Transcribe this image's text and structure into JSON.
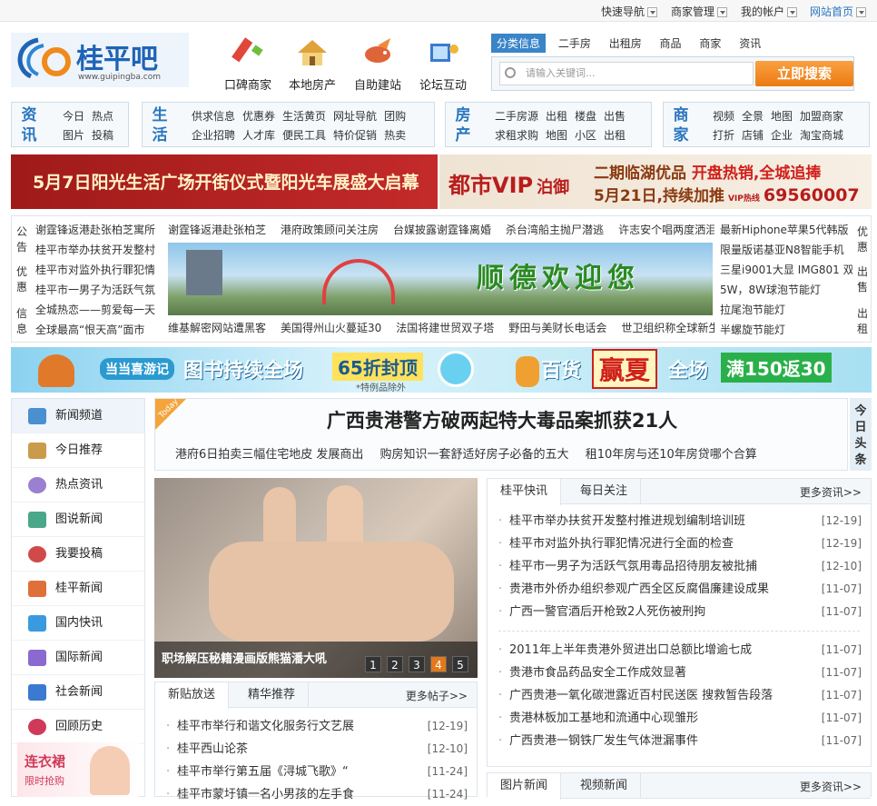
{
  "topbar": {
    "quick_nav": "快速导航",
    "merchant_mgmt": "商家管理",
    "my_account": "我的帐户",
    "home": "网站首页"
  },
  "logo": {
    "name": "桂平吧",
    "url_text": "www.guipingba.com"
  },
  "nav_icons": [
    {
      "label": "口碑商家",
      "icon": "pencil-icon"
    },
    {
      "label": "本地房产",
      "icon": "house-icon"
    },
    {
      "label": "自助建站",
      "icon": "bird-icon"
    },
    {
      "label": "论坛互动",
      "icon": "film-icon"
    }
  ],
  "search": {
    "tabs": [
      "分类信息",
      "二手房",
      "出租房",
      "商品",
      "商家",
      "资讯"
    ],
    "placeholder": "请输入关键词...",
    "button": "立即搜索"
  },
  "categories": [
    {
      "title": "资讯",
      "row1": [
        "今日",
        "热点"
      ],
      "row2": [
        "图片",
        "投稿"
      ]
    },
    {
      "title": "生活",
      "row1": [
        "供求信息",
        "优惠券",
        "生活黄页",
        "网址导航",
        "团购"
      ],
      "row2": [
        "企业招聘",
        "人才库",
        "便民工具",
        "特价促销",
        "热卖"
      ]
    },
    {
      "title": "房产",
      "row1": [
        "二手房源",
        "出租",
        "楼盘",
        "出售"
      ],
      "row2": [
        "求租求购",
        "地图",
        "小区",
        "出租"
      ]
    },
    {
      "title": "商家",
      "row1": [
        "视频",
        "全景",
        "地图",
        "加盟商家"
      ],
      "row2": [
        "打折",
        "店铺",
        "企业",
        "淘宝商城"
      ]
    }
  ],
  "banners": {
    "left": "5月7日阳光生活广场开街仪式暨阳光车展盛大启幕",
    "right_brand": "都市VIP",
    "right_sub": "泊御",
    "right_line1a": "二期临湖优品",
    "right_line1b": "开盘热销,全城追捧",
    "right_line2": "5月21日,持续加推",
    "right_vip": "VIP热线",
    "right_phone": "69560007"
  },
  "news3": {
    "left_labels": [
      "公告",
      "优惠",
      "信息"
    ],
    "right_labels": [
      "优惠",
      "出售",
      "出租"
    ],
    "col1": [
      "谢霆锋返港赴张柏芝寓所",
      "桂平市举办扶贫开发整村",
      "桂平市对监外执行罪犯情",
      "桂平市一男子为活跃气氛",
      "全城热恋——剪爱每一天",
      "全球最高“恨天高”面市"
    ],
    "col2a": [
      "谢霆锋返港赴张柏芝",
      "港府政策顾问关注房",
      "台媒披露谢霆锋离婚",
      "杀台湾船主抛尸潜逃",
      "许志安个唱两度洒泪"
    ],
    "col2b": [
      "维基解密网站遭黑客",
      "美国得州山火蔓延30",
      "法国将建世贸双子塔",
      "野田与美财长电话会",
      "世卫组织称全球新生"
    ],
    "center_text": "顺德欢迎您",
    "col3": [
      "最新Hiphone苹果5代韩版",
      "限量版诺基亚N8智能手机",
      "三星i9001大显 IMG801 双",
      "5W，8W球泡节能灯",
      "拉尾泡节能灯",
      "半螺旋节能灯"
    ]
  },
  "book_banner": {
    "brand": "当当喜游记",
    "t1": "图书持续全场",
    "t2": "65折封顶",
    "note": "*特例品除外",
    "t3": "百货",
    "t4": "赢夏",
    "t5": "全场",
    "t6": "满150返30"
  },
  "sidebar": [
    {
      "label": "新闻频道",
      "color": "#4a8fd0"
    },
    {
      "label": "今日推荐",
      "color": "#c99b4a"
    },
    {
      "label": "热点资讯",
      "color": "#9b7fd0"
    },
    {
      "label": "图说新闻",
      "color": "#4aa88a"
    },
    {
      "label": "我要投稿",
      "color": "#d04a4a"
    },
    {
      "label": "桂平新闻",
      "color": "#e0703a"
    },
    {
      "label": "国内快讯",
      "color": "#3a9ae0"
    },
    {
      "label": "国际新闻",
      "color": "#8a6ad0"
    },
    {
      "label": "社会新闻",
      "color": "#3a7ad0"
    },
    {
      "label": "回顾历史",
      "color": "#d03a5a"
    }
  ],
  "sidebar_ad": {
    "t1": "连衣裙",
    "t2": "限时抢购"
  },
  "headline": {
    "badge": "Today",
    "title": "广西贵港警方破两起特大毒品案抓获21人",
    "subs": [
      "港府6日拍卖三幅住宅地皮 发展商出",
      "购房知识一套舒适好房子必备的五大",
      "租10年房与还10年房贷哪个合算"
    ],
    "side_label": "今日头条"
  },
  "photo": {
    "caption": "职场解压秘籍漫画版熊猫潘大吼",
    "pages": [
      "1",
      "2",
      "3",
      "4",
      "5"
    ],
    "active": "4"
  },
  "forum_panel": {
    "tabs": [
      "新贴放送",
      "精华推荐"
    ],
    "more": "更多帖子>>",
    "items": [
      {
        "title": "桂平市举行和谐文化服务行文艺展",
        "date": "[12-19]"
      },
      {
        "title": "桂平西山论茶",
        "date": "[12-10]"
      },
      {
        "title": "桂平市举行第五届《浔城飞歌》“",
        "date": "[11-24]"
      },
      {
        "title": "桂平市蒙圩镇一名小男孩的左手食",
        "date": "[11-24]"
      }
    ]
  },
  "news_panel": {
    "tabs": [
      "桂平快讯",
      "每日关注"
    ],
    "more": "更多资讯>>",
    "group1": [
      {
        "title": "桂平市举办扶贫开发整村推进规划编制培训班",
        "date": "[12-19]"
      },
      {
        "title": "桂平市对监外执行罪犯情况进行全面的检查",
        "date": "[12-19]"
      },
      {
        "title": "桂平市一男子为活跃气氛用毒品招待朋友被批捕",
        "date": "[12-10]"
      },
      {
        "title": "贵港市外侨办组织参观广西全区反腐倡廉建设成果",
        "date": "[11-07]"
      },
      {
        "title": "广西一警官酒后开枪致2人死伤被刑拘",
        "date": "[11-07]"
      }
    ],
    "group2": [
      {
        "title": "2011年上半年贵港外贸进出口总额比增逾七成",
        "date": "[11-07]"
      },
      {
        "title": "贵港市食品药品安全工作成效显著",
        "date": "[11-07]"
      },
      {
        "title": "广西贵港一氧化碳泄露近百村民送医 搜救暂告段落",
        "date": "[11-07]"
      },
      {
        "title": "贵港林板加工基地和流通中心现雏形",
        "date": "[11-07]"
      },
      {
        "title": "广西贵港一钢铁厂发生气体泄漏事件",
        "date": "[11-07]"
      }
    ]
  },
  "photo_panel": {
    "tabs": [
      "图片新闻",
      "视频新闻"
    ],
    "more": "更多资讯>>"
  }
}
